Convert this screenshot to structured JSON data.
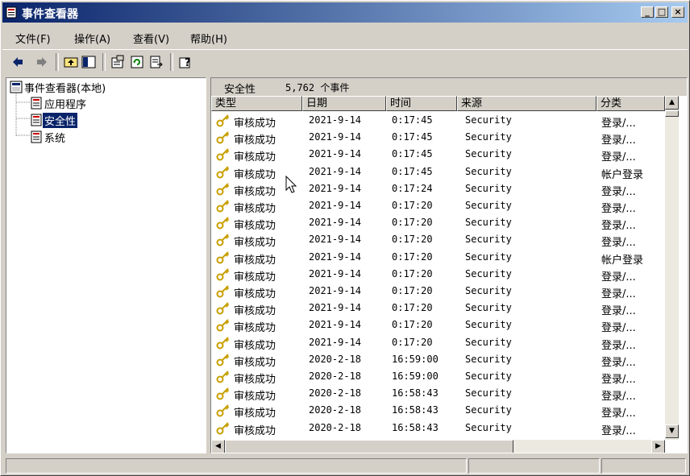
{
  "window": {
    "title": "事件查看器"
  },
  "menu": {
    "items": [
      "文件(F)",
      "操作(A)",
      "查看(V)",
      "帮助(H)"
    ]
  },
  "tree": {
    "root": "事件查看器(本地)",
    "items": [
      "应用程序",
      "安全性",
      "系统"
    ],
    "selected": "安全性"
  },
  "infobar": {
    "log_name": "安全性",
    "count_text": "5,762 个事件"
  },
  "columns": [
    "类型",
    "日期",
    "时间",
    "来源",
    "分类"
  ],
  "rows": [
    [
      "审核成功",
      "2021-9-14",
      "0:17:45",
      "Security",
      "登录/..."
    ],
    [
      "审核成功",
      "2021-9-14",
      "0:17:45",
      "Security",
      "登录/..."
    ],
    [
      "审核成功",
      "2021-9-14",
      "0:17:45",
      "Security",
      "登录/..."
    ],
    [
      "审核成功",
      "2021-9-14",
      "0:17:45",
      "Security",
      "帐户登录"
    ],
    [
      "审核成功",
      "2021-9-14",
      "0:17:24",
      "Security",
      "登录/..."
    ],
    [
      "审核成功",
      "2021-9-14",
      "0:17:20",
      "Security",
      "登录/..."
    ],
    [
      "审核成功",
      "2021-9-14",
      "0:17:20",
      "Security",
      "登录/..."
    ],
    [
      "审核成功",
      "2021-9-14",
      "0:17:20",
      "Security",
      "登录/..."
    ],
    [
      "审核成功",
      "2021-9-14",
      "0:17:20",
      "Security",
      "帐户登录"
    ],
    [
      "审核成功",
      "2021-9-14",
      "0:17:20",
      "Security",
      "登录/..."
    ],
    [
      "审核成功",
      "2021-9-14",
      "0:17:20",
      "Security",
      "登录/..."
    ],
    [
      "审核成功",
      "2021-9-14",
      "0:17:20",
      "Security",
      "登录/..."
    ],
    [
      "审核成功",
      "2021-9-14",
      "0:17:20",
      "Security",
      "登录/..."
    ],
    [
      "审核成功",
      "2021-9-14",
      "0:17:20",
      "Security",
      "登录/..."
    ],
    [
      "审核成功",
      "2020-2-18",
      "16:59:00",
      "Security",
      "登录/..."
    ],
    [
      "审核成功",
      "2020-2-18",
      "16:59:00",
      "Security",
      "登录/..."
    ],
    [
      "审核成功",
      "2020-2-18",
      "16:58:43",
      "Security",
      "登录/..."
    ],
    [
      "审核成功",
      "2020-2-18",
      "16:58:43",
      "Security",
      "登录/..."
    ],
    [
      "审核成功",
      "2020-2-18",
      "16:58:43",
      "Security",
      "登录/..."
    ]
  ],
  "colors": {
    "title_start": "#0a246a",
    "title_end": "#a6caf0",
    "key_icon": "#c8a000"
  }
}
